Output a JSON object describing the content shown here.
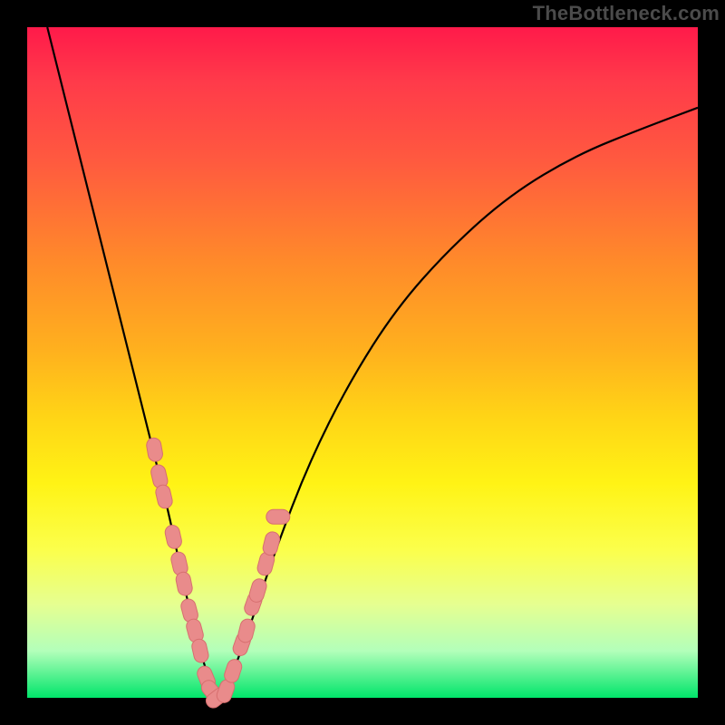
{
  "watermark": "TheBottleneck.com",
  "colors": {
    "curve_stroke": "#000000",
    "marker_fill": "#e98b8b",
    "marker_stroke": "#d76f6f",
    "background": "#000000"
  },
  "chart_data": {
    "type": "line",
    "title": "",
    "xlabel": "",
    "ylabel": "",
    "xlim": [
      0,
      100
    ],
    "ylim": [
      0,
      100
    ],
    "grid": false,
    "legend": false,
    "note": "V-shaped bottleneck curve; y-axis inverted visually (0 at bottom = green/optimal, 100 at top = red/bottleneck). Values estimated from pixel positions.",
    "series": [
      {
        "name": "bottleneck-curve",
        "x": [
          3,
          6,
          9,
          12,
          15,
          17,
          19,
          21,
          22.5,
          24,
          25.5,
          27,
          28.5,
          30,
          33,
          37,
          42,
          48,
          55,
          63,
          72,
          82,
          92,
          100
        ],
        "y": [
          100,
          88,
          76,
          64,
          52,
          44,
          36,
          28,
          21,
          14,
          8,
          3,
          0,
          2,
          10,
          22,
          35,
          47,
          58,
          67,
          75,
          81,
          85,
          88
        ]
      }
    ],
    "markers": {
      "name": "highlighted-points",
      "points": [
        {
          "x": 19.0,
          "y": 37
        },
        {
          "x": 19.7,
          "y": 33
        },
        {
          "x": 20.4,
          "y": 30
        },
        {
          "x": 21.8,
          "y": 24
        },
        {
          "x": 22.7,
          "y": 20
        },
        {
          "x": 23.4,
          "y": 17
        },
        {
          "x": 24.2,
          "y": 13
        },
        {
          "x": 25.0,
          "y": 10
        },
        {
          "x": 25.8,
          "y": 7
        },
        {
          "x": 26.7,
          "y": 3
        },
        {
          "x": 27.5,
          "y": 1
        },
        {
          "x": 28.3,
          "y": 0
        },
        {
          "x": 29.6,
          "y": 1
        },
        {
          "x": 30.7,
          "y": 4
        },
        {
          "x": 32.0,
          "y": 8
        },
        {
          "x": 32.7,
          "y": 10
        },
        {
          "x": 33.7,
          "y": 14
        },
        {
          "x": 34.4,
          "y": 16
        },
        {
          "x": 35.6,
          "y": 20
        },
        {
          "x": 36.4,
          "y": 23
        },
        {
          "x": 37.4,
          "y": 27
        }
      ]
    }
  }
}
